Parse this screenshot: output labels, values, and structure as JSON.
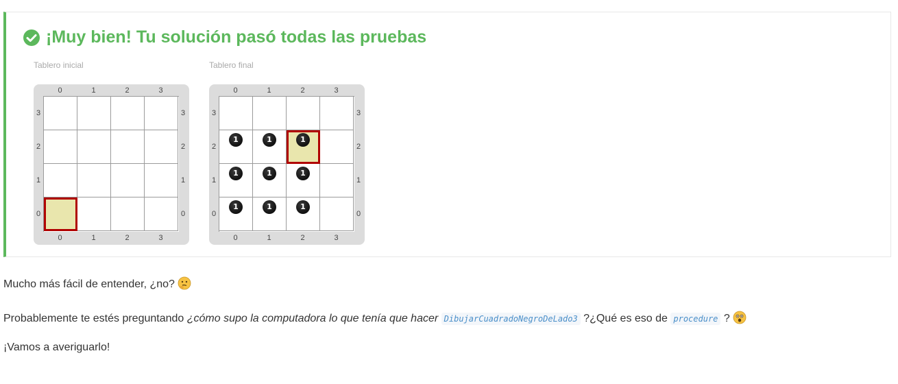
{
  "result": {
    "title": "¡Muy bien! Tu solución pasó todas las pruebas",
    "status_color": "#5cb85c",
    "icon": "check-circle-icon"
  },
  "boards": [
    {
      "caption": "Tablero inicial",
      "columns": [
        "0",
        "1",
        "2",
        "3"
      ],
      "rows": [
        "3",
        "2",
        "1",
        "0"
      ],
      "head": {
        "col": 0,
        "row": 0
      },
      "stones": []
    },
    {
      "caption": "Tablero final",
      "columns": [
        "0",
        "1",
        "2",
        "3"
      ],
      "rows": [
        "3",
        "2",
        "1",
        "0"
      ],
      "head": {
        "col": 2,
        "row": 2
      },
      "stones": [
        {
          "col": 0,
          "row": 2,
          "count": "1"
        },
        {
          "col": 1,
          "row": 2,
          "count": "1"
        },
        {
          "col": 2,
          "row": 2,
          "count": "1"
        },
        {
          "col": 0,
          "row": 1,
          "count": "1"
        },
        {
          "col": 1,
          "row": 1,
          "count": "1"
        },
        {
          "col": 2,
          "row": 1,
          "count": "1"
        },
        {
          "col": 0,
          "row": 0,
          "count": "1"
        },
        {
          "col": 1,
          "row": 0,
          "count": "1"
        },
        {
          "col": 2,
          "row": 0,
          "count": "1"
        }
      ]
    }
  ],
  "paragraphs": {
    "p1": "Mucho más fácil de entender, ¿no?",
    "p1_emoji": "thinking-face-icon",
    "p2_prefix": "Probablemente te estés preguntando ",
    "p2_italic": "¿cómo supo la computadora lo que tenía que hacer",
    "p2_code1": "DibujarCuadradoNegroDeLado3",
    "p2_mid": " ?¿Qué es eso de ",
    "p2_code2": "procedure",
    "p2_end": " ?",
    "p2_emoji": "astonished-face-icon",
    "p3": "¡Vamos a averiguarlo!"
  },
  "colors": {
    "head_fill": "#e9e6ad",
    "head_border": "#b00000",
    "frame": "#dcdcdc"
  }
}
